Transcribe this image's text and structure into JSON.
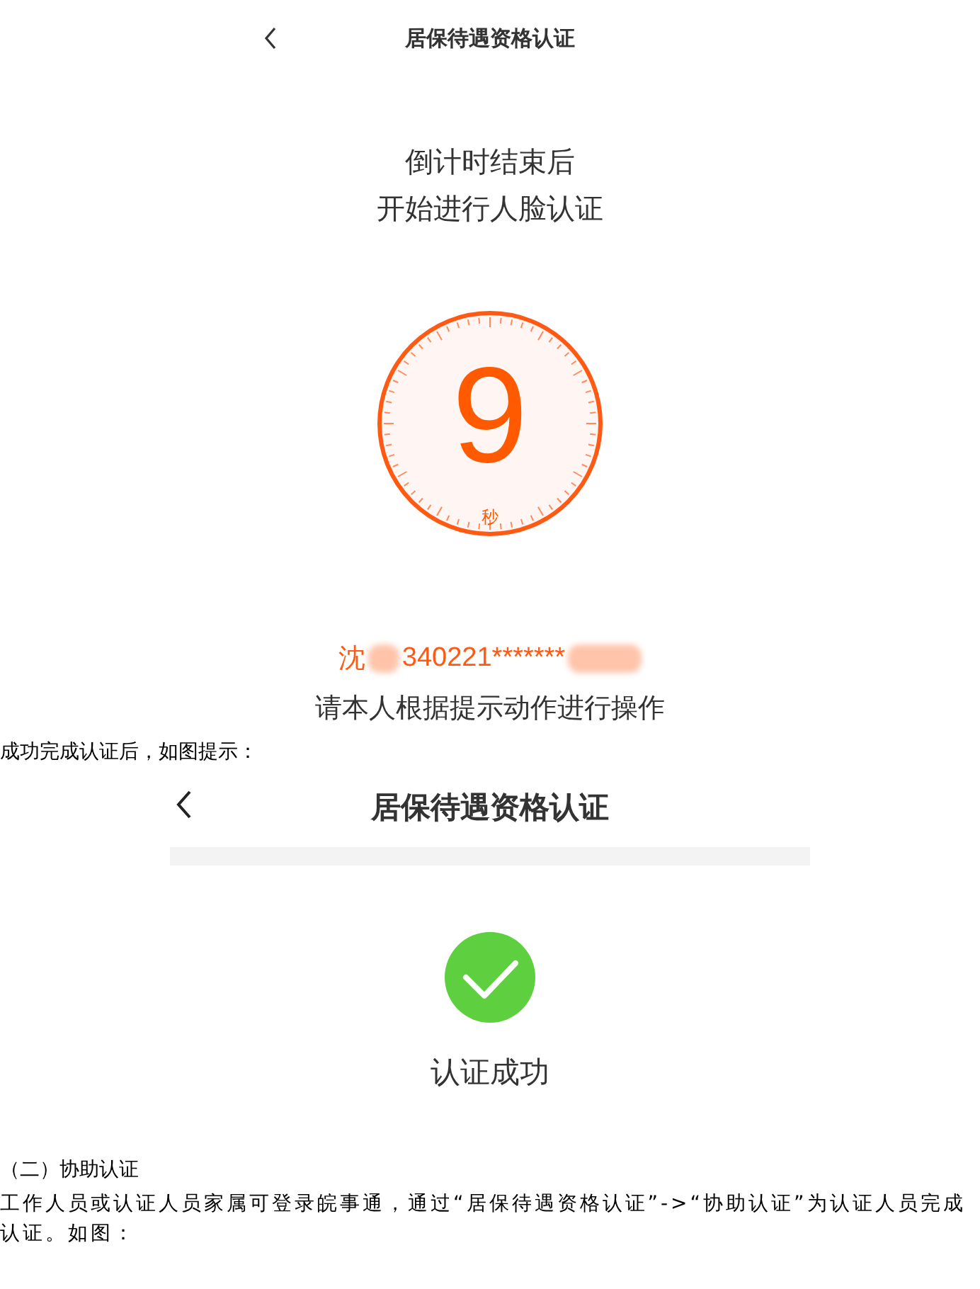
{
  "screen_countdown": {
    "title": "居保待遇资格认证",
    "prompt_lines": [
      "倒计时结束后",
      "开始进行人脸认证"
    ],
    "countdown": {
      "number": "9",
      "unit": "秒"
    },
    "id_line": {
      "name": "沈",
      "id_number": "340221*******"
    },
    "instruction": "请本人根据提示动作进行操作"
  },
  "caption_1": "成功完成认证后，如图提示：",
  "screen_success": {
    "title": "居保待遇资格认证",
    "status": "认证成功"
  },
  "section_heading": "（二）协助认证",
  "paragraph": "工作人员或认证人员家属可登录皖事通，通过“居保待遇资格认证”->“协助认证”为认证人员完成认证。如图："
}
